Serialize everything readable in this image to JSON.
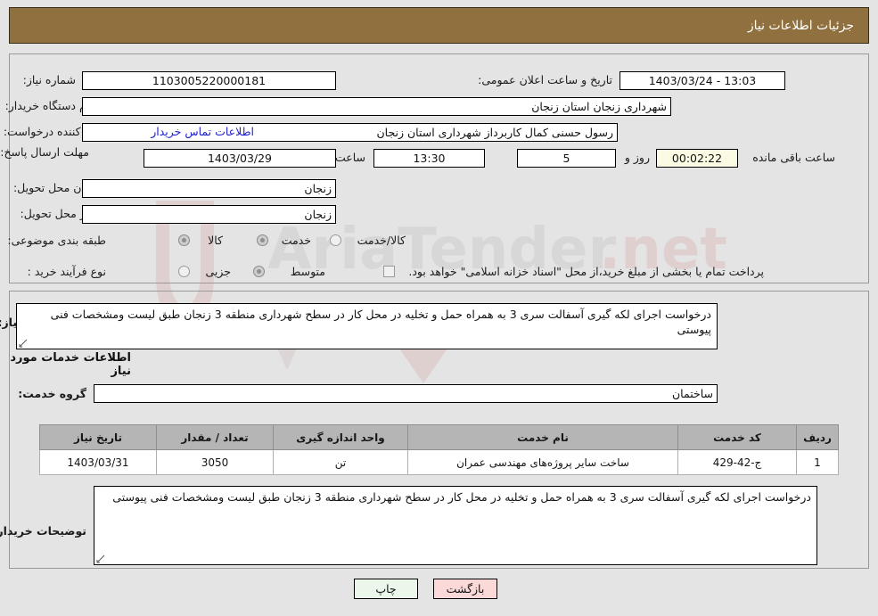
{
  "header": {
    "title": "جزئیات اطلاعات نیاز"
  },
  "form": {
    "need_number_label": "شماره نیاز:",
    "need_number_value": "1103005220000181",
    "announce_datetime_label": "تاریخ و ساعت اعلان عمومی:",
    "announce_datetime_value": "13:03 - 1403/03/24",
    "buyer_org_label": "نام دستگاه خریدار:",
    "buyer_org_value": "شهرداری زنجان استان زنجان",
    "creator_label": "ایجاد کننده درخواست:",
    "creator_value": "رسول حسنی کمال کاربرداز شهرداری استان زنجان",
    "buyer_contact_link": "اطلاعات تماس خریدار",
    "deadline_label": "مهلت ارسال پاسخ: تا تاریخ:",
    "deadline_date": "1403/03/29",
    "deadline_hour_label": "ساعت",
    "deadline_hour": "13:30",
    "days_remaining": "5",
    "days_word": "روز و",
    "time_remaining": "00:02:22",
    "time_remaining_suffix": "ساعت باقی مانده",
    "province_label": "استان محل تحویل:",
    "province_value": "زنجان",
    "city_label": "شهر محل تحویل:",
    "city_value": "زنجان",
    "category_label": "طبقه بندی موضوعی:",
    "category_options": [
      {
        "label": "کالا",
        "selected": false
      },
      {
        "label": "خدمت",
        "selected": true
      },
      {
        "label": "کالا/خدمت",
        "selected": false
      }
    ],
    "process_label": "نوع فرآیند خرید :",
    "process_options": [
      {
        "label": "جزیی",
        "selected": false
      },
      {
        "label": "متوسط",
        "selected": true
      }
    ],
    "payment_checkbox_label": "پرداخت تمام یا بخشی از مبلغ خرید،از محل \"اسناد خزانه اسلامی\" خواهد بود.",
    "payment_checkbox_checked": false
  },
  "description": {
    "label": "شرح کلی نیاز:",
    "value": "درخواست اجرای لکه گیری آسفالت سری 3 به همراه حمل و تخلیه در محل کار در سطح شهرداری منطقه 3 زنجان طبق لیست ومشخصات فنی پیوستی"
  },
  "services": {
    "section_title": "اطلاعات خدمات مورد نیاز",
    "group_label": "گروه خدمت:",
    "group_value": "ساختمان",
    "columns": [
      "ردیف",
      "کد خدمت",
      "نام خدمت",
      "واحد اندازه گیری",
      "تعداد / مقدار",
      "تاریخ نیاز"
    ],
    "rows": [
      {
        "row": "1",
        "code": "ج-42-429",
        "name": "ساخت سایر پروژه‌های مهندسی عمران",
        "unit": "تن",
        "quantity": "3050",
        "date": "1403/03/31"
      }
    ]
  },
  "buyer_notes": {
    "label": "توضیحات خریدار:",
    "value": "درخواست اجرای لکه گیری آسفالت سری 3 به همراه حمل و تخلیه در محل کار در سطح شهرداری منطقه 3 زنجان طبق لیست ومشخصات فنی پیوستی"
  },
  "footer": {
    "print_label": "چاپ",
    "back_label": "بازگشت"
  },
  "colors": {
    "header_bg": "#90703f",
    "page_bg": "#e4e4e4",
    "link": "#1d1dd0",
    "table_header_bg": "#b5b5b5",
    "print_btn_bg": "#eaf7ea",
    "back_btn_bg": "#fbd9d9",
    "countdown_bg": "#fbfbe4"
  }
}
